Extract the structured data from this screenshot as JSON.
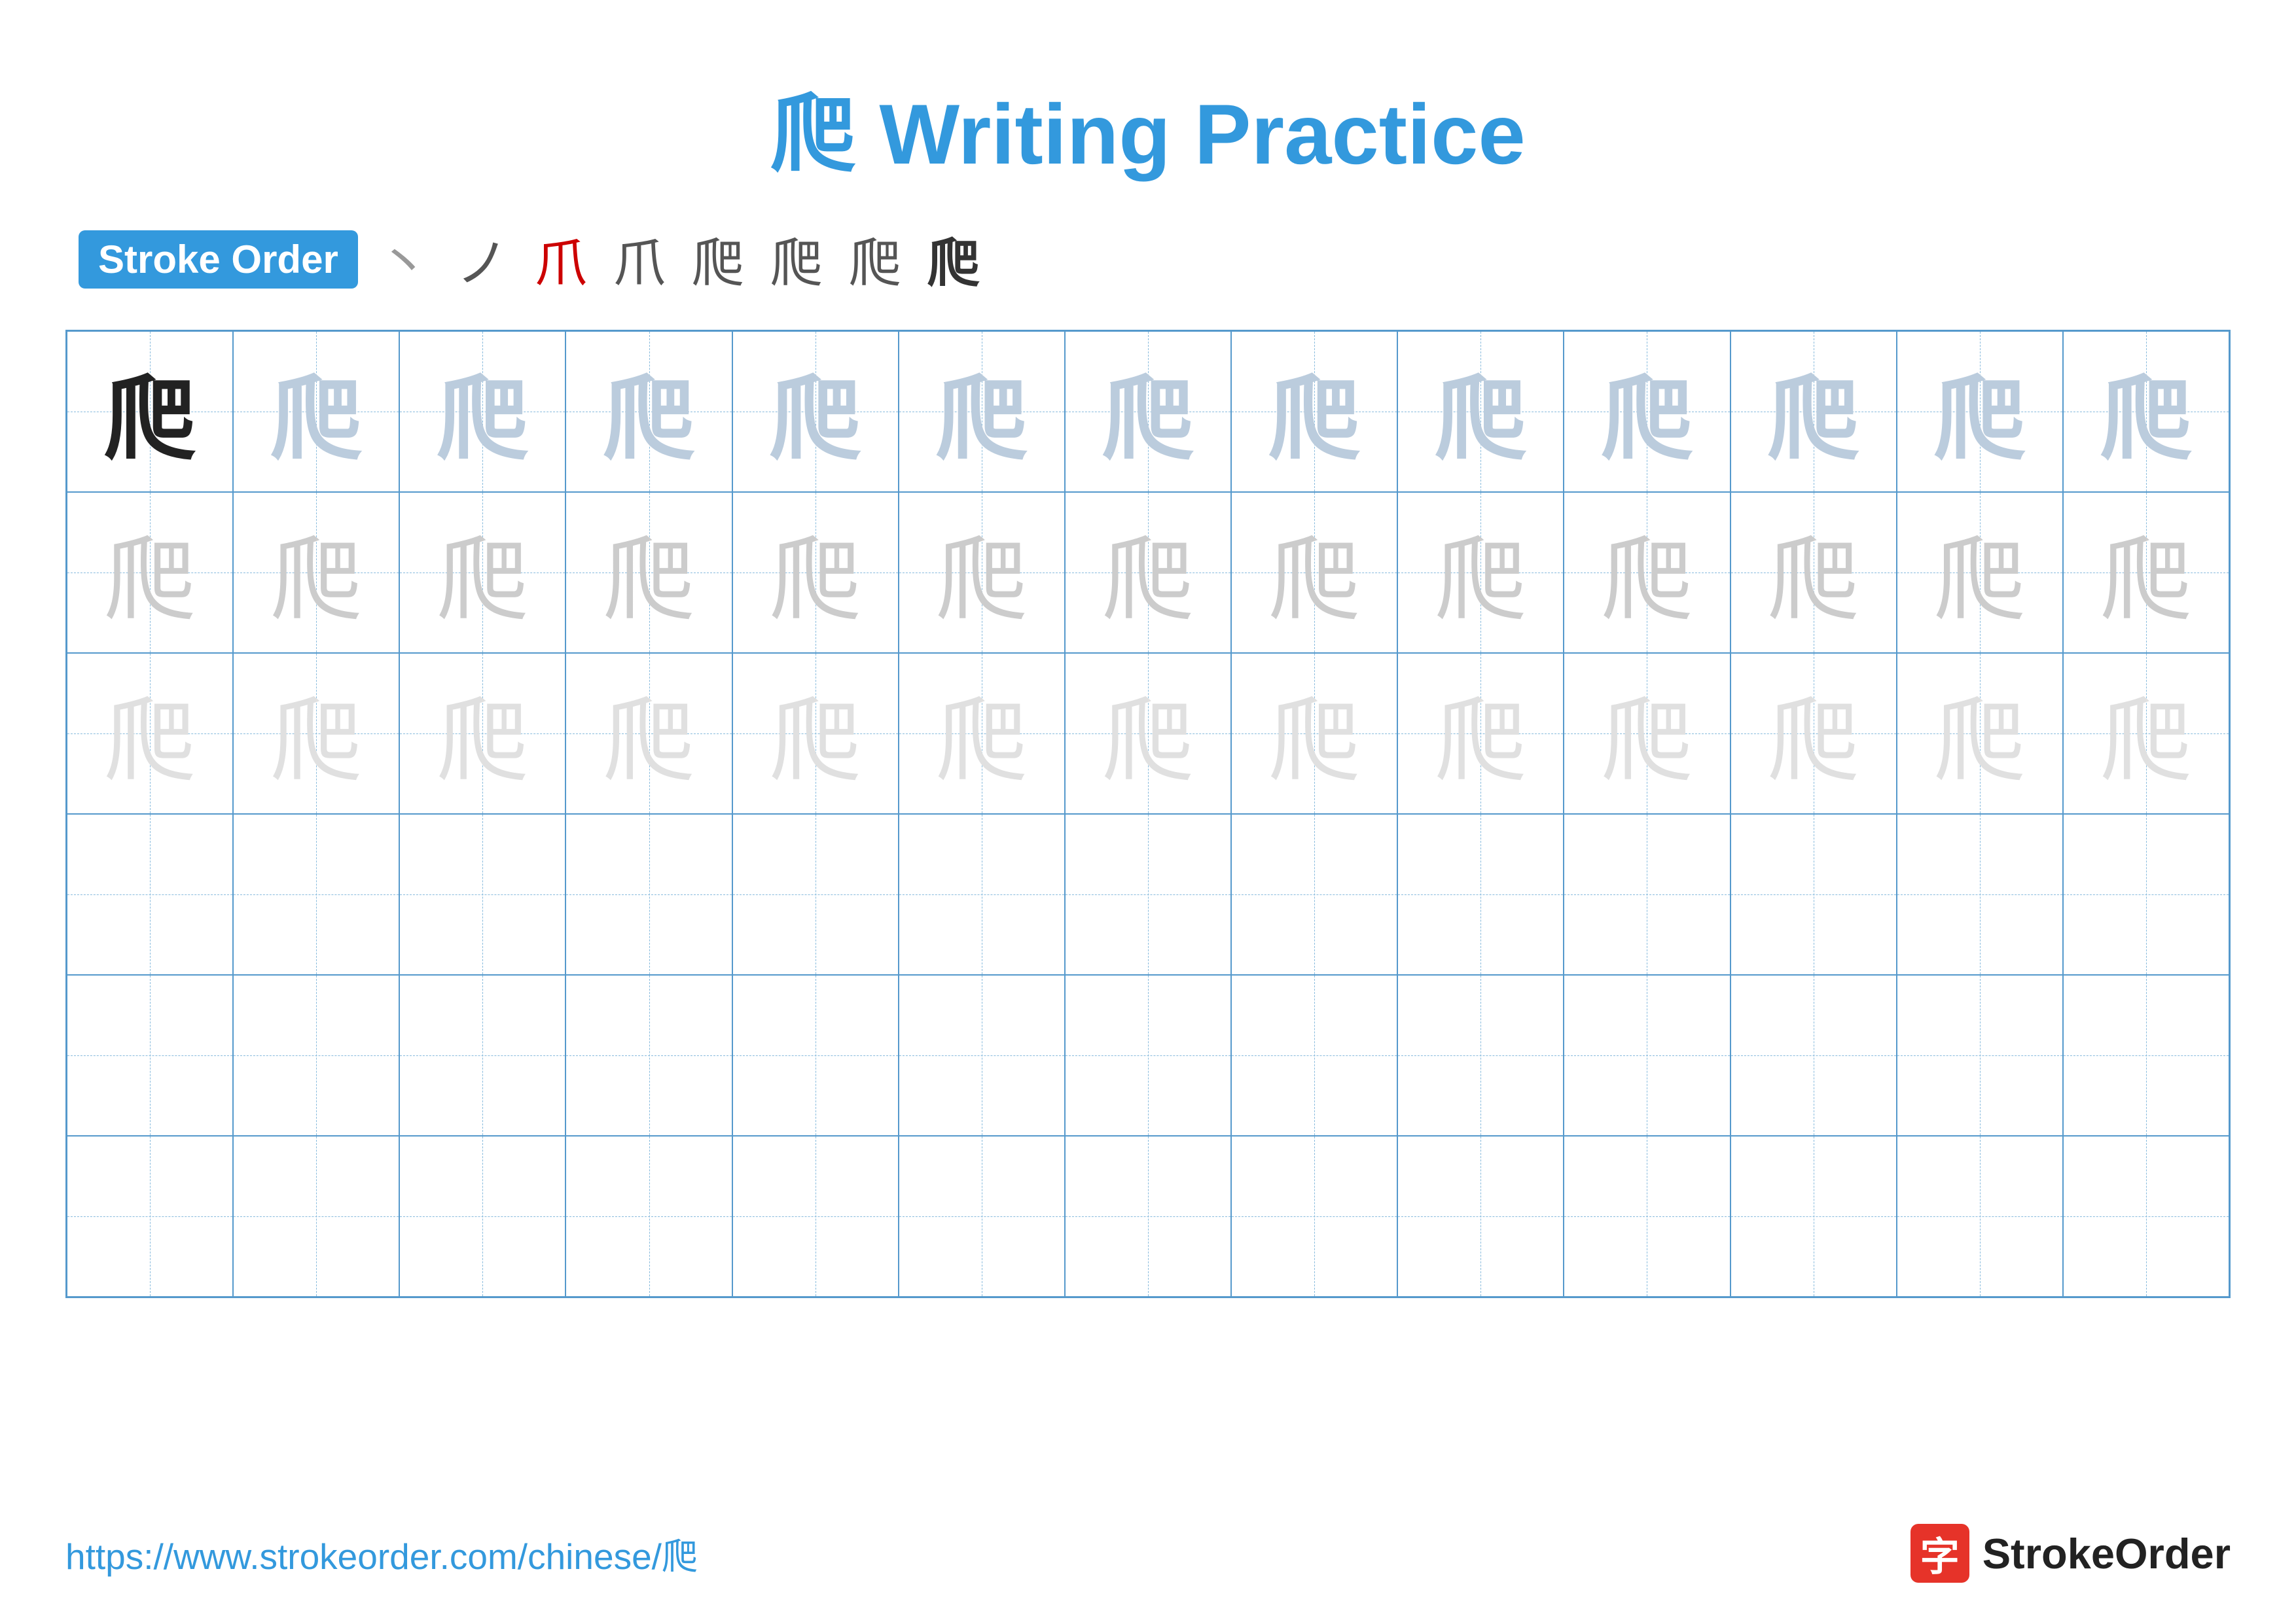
{
  "title": {
    "char": "爬",
    "text": "Writing Practice",
    "full": "爬 Writing Practice"
  },
  "stroke_order": {
    "badge_label": "Stroke Order",
    "steps": [
      "丶",
      "ノ",
      "𠄌",
      "爪",
      "爬",
      "爬",
      "爬",
      "爬"
    ]
  },
  "grid": {
    "rows": 6,
    "cols": 13,
    "char": "爬",
    "row_styles": [
      "dark",
      "medium",
      "light",
      "empty",
      "empty",
      "empty"
    ]
  },
  "footer": {
    "url": "https://www.strokeorder.com/chinese/爬",
    "logo_char": "字",
    "logo_name": "StrokeOrder"
  }
}
